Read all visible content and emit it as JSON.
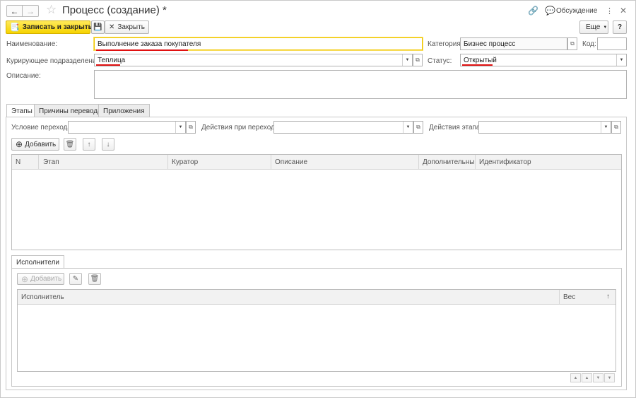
{
  "window": {
    "title": "Процесс (создание) *",
    "discussion_label": "Обсуждение"
  },
  "toolbar": {
    "save_close_label": "Записать и закрыть",
    "close_label": "Закрыть",
    "more_label": "Еще",
    "help_label": "?"
  },
  "form": {
    "name_label": "Наименование:",
    "name_value": "Выполнение заказа покупателя",
    "category_label": "Категория:",
    "category_value": "Бизнес процесс",
    "code_label": "Код:",
    "code_value": "",
    "department_label": "Курирующее подразделение:",
    "department_value": "Теплица",
    "status_label": "Статус:",
    "status_value": "Открытый",
    "description_label": "Описание:",
    "description_value": ""
  },
  "tabs": [
    {
      "label": "Этапы"
    },
    {
      "label": "Причины перевода"
    },
    {
      "label": "Приложения"
    }
  ],
  "stages": {
    "transition_condition_label": "Условие перехода:",
    "transition_actions_label": "Действия при переходе:",
    "stage_actions_label": "Действия этапа:",
    "add_label": "Добавить",
    "columns": [
      "N",
      "Этап",
      "Куратор",
      "Описание",
      "Дополнительный",
      "Идентификатор"
    ]
  },
  "performers": {
    "tab_label": "Исполнители",
    "add_label": "Добавить",
    "columns": [
      "Исполнитель",
      "Вес"
    ]
  },
  "colors": {
    "primary_button": "#f6d300",
    "underline": "#e01010",
    "focus_border": "#f1c700"
  }
}
